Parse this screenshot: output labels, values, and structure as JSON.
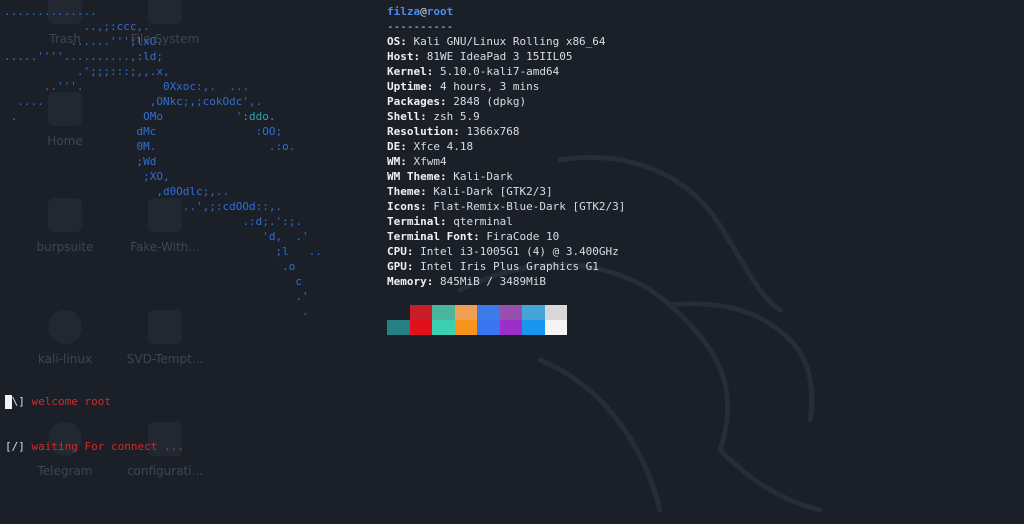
{
  "desktop": {
    "icons": [
      {
        "label": "Trash",
        "icon": "trash-icon"
      },
      {
        "label": "File System",
        "icon": "filesystem-icon"
      },
      {
        "label": "Home",
        "icon": "home-icon"
      },
      {
        "label": "burpsuite",
        "icon": "burpsuite-icon"
      },
      {
        "label": "Fake-With...",
        "icon": "file-icon"
      },
      {
        "label": "kali-linux",
        "icon": "kali-icon"
      },
      {
        "label": "SVD-Tempt...",
        "icon": "file-icon"
      },
      {
        "label": "Telegram",
        "icon": "gear-icon"
      },
      {
        "label": "configurati...",
        "icon": "file-icon"
      }
    ]
  },
  "terminal": {
    "ascii_art": [
      "..............",
      "            ..,;:ccc,.",
      "          ......''';lxO.",
      ".....''''..........,:ld;",
      "           .';;;:::;,,.x,",
      "      ..'''.            0Xxoc:,.  ...",
      "  ....                ,ONkc;,;cokOdc',.",
      " .                   OMo           ':ddo.",
      "                    dMc               :OO;",
      "                    0M.                 .:o.",
      "                    ;Wd",
      "                     ;XO,",
      "                       ,d0Odlc;,..",
      "                           ..',;:cdOOd::,.",
      "                                    .:d;.':;.",
      "                                       'd,  .'",
      "                                         ;l   ..",
      "                                          .o",
      "                                            c",
      "                                            .'",
      "                                             ."
    ],
    "user": "filza",
    "at": "@",
    "host": "root",
    "separator": "----------",
    "info": [
      {
        "key": "OS:",
        "value": "Kali GNU/Linux Rolling x86_64"
      },
      {
        "key": "Host:",
        "value": "81WE IdeaPad 3 15IIL05"
      },
      {
        "key": "Kernel:",
        "value": "5.10.0-kali7-amd64"
      },
      {
        "key": "Uptime:",
        "value": "4 hours, 3 mins"
      },
      {
        "key": "Packages:",
        "value": "2848 (dpkg)"
      },
      {
        "key": "Shell:",
        "value": "zsh 5.9"
      },
      {
        "key": "Resolution:",
        "value": "1366x768"
      },
      {
        "key": "DE:",
        "value": "Xfce 4.18"
      },
      {
        "key": "WM:",
        "value": "Xfwm4"
      },
      {
        "key": "WM Theme:",
        "value": "Kali-Dark"
      },
      {
        "key": "Theme:",
        "value": "Kali-Dark [GTK2/3]"
      },
      {
        "key": "Icons:",
        "value": "Flat-Remix-Blue-Dark [GTK2/3]"
      },
      {
        "key": "Terminal:",
        "value": "qterminal"
      },
      {
        "key": "Terminal Font:",
        "value": "FiraCode 10"
      },
      {
        "key": "CPU:",
        "value": "Intel i3-1005G1 (4) @ 3.400GHz"
      },
      {
        "key": "GPU:",
        "value": "Intel Iris Plus Graphics G1"
      },
      {
        "key": "Memory:",
        "value": "845MiB / 3489MiB"
      }
    ],
    "palette_top": [
      "#1b1f27",
      "#c81e2a",
      "#49b59e",
      "#f0a050",
      "#3b7ce8",
      "#9a4fb0",
      "#44a6d8",
      "#d8d8d8"
    ],
    "palette_bottom": [
      "#248081",
      "#e0101c",
      "#3ccfb0",
      "#f7941d",
      "#3a74ef",
      "#9b30c8",
      "#1a96ee",
      "#f4f4f4"
    ],
    "messages": [
      {
        "symbol": "\\",
        "text": " welcome root"
      },
      {
        "symbol": "/",
        "text": " waiting For connect ..."
      }
    ]
  }
}
